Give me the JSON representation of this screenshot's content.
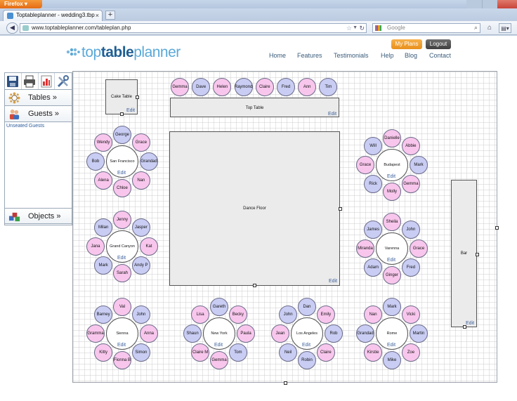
{
  "browser": {
    "menu_label": "Firefox",
    "tab_title": "Toptableplanner - wedding3.tbp",
    "new_tab": "+",
    "url": "www.toptableplanner.com/tableplan.php",
    "search_placeholder": "Google"
  },
  "site": {
    "logo": {
      "top": "top",
      "table": "table",
      "planner": "planner"
    },
    "my_plans": "My Plans",
    "logout": "Logout",
    "nav": [
      "Home",
      "Features",
      "Testimonials",
      "Help",
      "Blog",
      "Contact"
    ]
  },
  "sidebar": {
    "tables": "Tables »",
    "guests": "Guests »",
    "unseated": "Unseated Guests",
    "objects": "Objects »"
  },
  "objects": {
    "cake_table": "Cake Table",
    "top_table": "Top Table",
    "dance_floor": "Dance Floor",
    "bar": "Bar",
    "edit": "Edit"
  },
  "top_table_guests": [
    {
      "name": "Gemma",
      "g": "f"
    },
    {
      "name": "Dave",
      "g": "m"
    },
    {
      "name": "Helen",
      "g": "f"
    },
    {
      "name": "Raymond",
      "g": "m"
    },
    {
      "name": "Claire",
      "g": "f"
    },
    {
      "name": "Fred",
      "g": "m"
    },
    {
      "name": "Ann",
      "g": "f"
    },
    {
      "name": "Tim",
      "g": "m"
    }
  ],
  "round_tables": [
    {
      "name": "San Francisco",
      "guests": [
        {
          "name": "George",
          "g": "m"
        },
        {
          "name": "Grace",
          "g": "f"
        },
        {
          "name": "Grandad",
          "g": "m"
        },
        {
          "name": "Nan",
          "g": "f"
        },
        {
          "name": "Chloe",
          "g": "f"
        },
        {
          "name": "Alena",
          "g": "f"
        },
        {
          "name": "Bob",
          "g": "m"
        },
        {
          "name": "Wendy",
          "g": "f"
        }
      ]
    },
    {
      "name": "Budapest",
      "guests": [
        {
          "name": "Danielle",
          "g": "f"
        },
        {
          "name": "Abbie",
          "g": "f"
        },
        {
          "name": "Mark",
          "g": "m"
        },
        {
          "name": "Gemma",
          "g": "f"
        },
        {
          "name": "Molly",
          "g": "f"
        },
        {
          "name": "Rick",
          "g": "m"
        },
        {
          "name": "Grace",
          "g": "f"
        },
        {
          "name": "Will",
          "g": "m"
        }
      ]
    },
    {
      "name": "Grand Canyon",
      "guests": [
        {
          "name": "Jenny",
          "g": "f"
        },
        {
          "name": "Jasper",
          "g": "m"
        },
        {
          "name": "Kat",
          "g": "f"
        },
        {
          "name": "Andy P",
          "g": "m"
        },
        {
          "name": "Sarah",
          "g": "f"
        },
        {
          "name": "Mark",
          "g": "m"
        },
        {
          "name": "Jana",
          "g": "f"
        },
        {
          "name": "Milan",
          "g": "m"
        }
      ]
    },
    {
      "name": "Varenna",
      "guests": [
        {
          "name": "Sheila",
          "g": "f"
        },
        {
          "name": "John",
          "g": "m"
        },
        {
          "name": "Grace",
          "g": "f"
        },
        {
          "name": "Fred",
          "g": "m"
        },
        {
          "name": "Ginger",
          "g": "f"
        },
        {
          "name": "Adam",
          "g": "m"
        },
        {
          "name": "Miranda",
          "g": "f"
        },
        {
          "name": "James",
          "g": "m"
        }
      ]
    },
    {
      "name": "Sienna",
      "guests": [
        {
          "name": "Val",
          "g": "f"
        },
        {
          "name": "John",
          "g": "m"
        },
        {
          "name": "Anna",
          "g": "f"
        },
        {
          "name": "Simon",
          "g": "m"
        },
        {
          "name": "Fionna B",
          "g": "f"
        },
        {
          "name": "Kitty",
          "g": "f"
        },
        {
          "name": "Gramma",
          "g": "f"
        },
        {
          "name": "Barney",
          "g": "m"
        }
      ]
    },
    {
      "name": "New York",
      "guests": [
        {
          "name": "Gareth",
          "g": "m"
        },
        {
          "name": "Becky",
          "g": "f"
        },
        {
          "name": "Paula",
          "g": "f"
        },
        {
          "name": "Tom",
          "g": "m"
        },
        {
          "name": "Gemma",
          "g": "f"
        },
        {
          "name": "Claire M",
          "g": "f"
        },
        {
          "name": "Shaun",
          "g": "m"
        },
        {
          "name": "Lisa",
          "g": "f"
        }
      ]
    },
    {
      "name": "Los Angeles",
      "guests": [
        {
          "name": "Dan",
          "g": "m"
        },
        {
          "name": "Emily",
          "g": "f"
        },
        {
          "name": "Rob",
          "g": "m"
        },
        {
          "name": "Claire",
          "g": "f"
        },
        {
          "name": "Robin",
          "g": "m"
        },
        {
          "name": "Neil",
          "g": "m"
        },
        {
          "name": "Jean",
          "g": "f"
        },
        {
          "name": "John",
          "g": "m"
        }
      ]
    },
    {
      "name": "Rome",
      "guests": [
        {
          "name": "Mark",
          "g": "m"
        },
        {
          "name": "Vicki",
          "g": "f"
        },
        {
          "name": "Martin",
          "g": "m"
        },
        {
          "name": "Zoe",
          "g": "f"
        },
        {
          "name": "Mike",
          "g": "m"
        },
        {
          "name": "Kirstie",
          "g": "f"
        },
        {
          "name": "Grandad",
          "g": "m"
        },
        {
          "name": "Nan",
          "g": "f"
        }
      ]
    }
  ]
}
